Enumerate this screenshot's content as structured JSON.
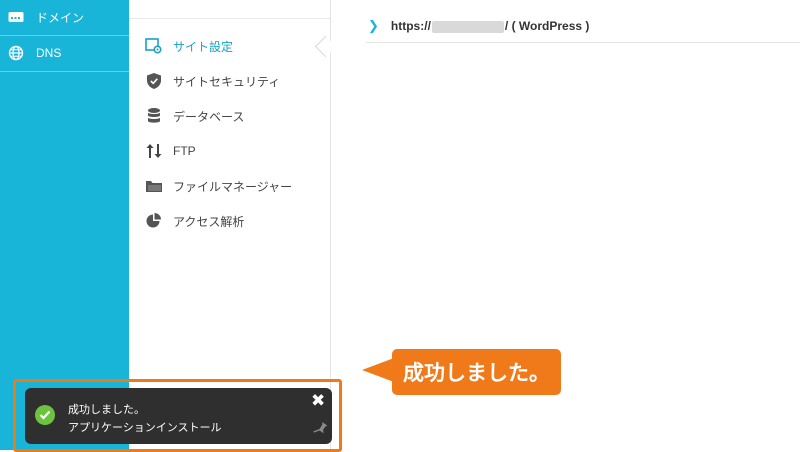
{
  "sidebar": {
    "items": [
      {
        "label": "ドメイン",
        "icon": "domain-icon"
      },
      {
        "label": "DNS",
        "icon": "globe-icon"
      }
    ]
  },
  "subnav": {
    "items": [
      {
        "label": "サイト設定",
        "icon": "site-settings-icon",
        "active": true
      },
      {
        "label": "サイトセキュリティ",
        "icon": "shield-icon"
      },
      {
        "label": "データベース",
        "icon": "database-icon"
      },
      {
        "label": "FTP",
        "icon": "transfer-arrows-icon"
      },
      {
        "label": "ファイルマネージャー",
        "icon": "folder-icon"
      },
      {
        "label": "アクセス解析",
        "icon": "pie-chart-icon"
      }
    ]
  },
  "content": {
    "url_prefix": "https://",
    "url_suffix": "/ ( WordPress )"
  },
  "callout": {
    "text": "成功しました。"
  },
  "toast": {
    "title": "成功しました。",
    "message": "アプリケーションインストール"
  },
  "colors": {
    "accent": "#19b5d8",
    "callout": "#f07a1a",
    "success": "#6cc33f",
    "toast_bg": "#2f2f2f"
  }
}
